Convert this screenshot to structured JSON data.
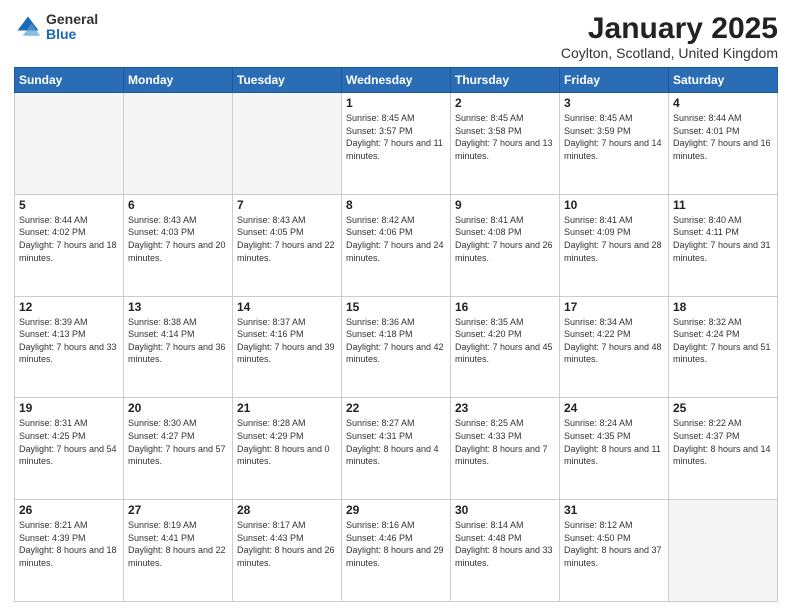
{
  "logo": {
    "general": "General",
    "blue": "Blue"
  },
  "header": {
    "title": "January 2025",
    "location": "Coylton, Scotland, United Kingdom"
  },
  "days_of_week": [
    "Sunday",
    "Monday",
    "Tuesday",
    "Wednesday",
    "Thursday",
    "Friday",
    "Saturday"
  ],
  "weeks": [
    [
      {
        "day": "",
        "info": ""
      },
      {
        "day": "",
        "info": ""
      },
      {
        "day": "",
        "info": ""
      },
      {
        "day": "1",
        "info": "Sunrise: 8:45 AM\nSunset: 3:57 PM\nDaylight: 7 hours\nand 11 minutes."
      },
      {
        "day": "2",
        "info": "Sunrise: 8:45 AM\nSunset: 3:58 PM\nDaylight: 7 hours\nand 13 minutes."
      },
      {
        "day": "3",
        "info": "Sunrise: 8:45 AM\nSunset: 3:59 PM\nDaylight: 7 hours\nand 14 minutes."
      },
      {
        "day": "4",
        "info": "Sunrise: 8:44 AM\nSunset: 4:01 PM\nDaylight: 7 hours\nand 16 minutes."
      }
    ],
    [
      {
        "day": "5",
        "info": "Sunrise: 8:44 AM\nSunset: 4:02 PM\nDaylight: 7 hours\nand 18 minutes."
      },
      {
        "day": "6",
        "info": "Sunrise: 8:43 AM\nSunset: 4:03 PM\nDaylight: 7 hours\nand 20 minutes."
      },
      {
        "day": "7",
        "info": "Sunrise: 8:43 AM\nSunset: 4:05 PM\nDaylight: 7 hours\nand 22 minutes."
      },
      {
        "day": "8",
        "info": "Sunrise: 8:42 AM\nSunset: 4:06 PM\nDaylight: 7 hours\nand 24 minutes."
      },
      {
        "day": "9",
        "info": "Sunrise: 8:41 AM\nSunset: 4:08 PM\nDaylight: 7 hours\nand 26 minutes."
      },
      {
        "day": "10",
        "info": "Sunrise: 8:41 AM\nSunset: 4:09 PM\nDaylight: 7 hours\nand 28 minutes."
      },
      {
        "day": "11",
        "info": "Sunrise: 8:40 AM\nSunset: 4:11 PM\nDaylight: 7 hours\nand 31 minutes."
      }
    ],
    [
      {
        "day": "12",
        "info": "Sunrise: 8:39 AM\nSunset: 4:13 PM\nDaylight: 7 hours\nand 33 minutes."
      },
      {
        "day": "13",
        "info": "Sunrise: 8:38 AM\nSunset: 4:14 PM\nDaylight: 7 hours\nand 36 minutes."
      },
      {
        "day": "14",
        "info": "Sunrise: 8:37 AM\nSunset: 4:16 PM\nDaylight: 7 hours\nand 39 minutes."
      },
      {
        "day": "15",
        "info": "Sunrise: 8:36 AM\nSunset: 4:18 PM\nDaylight: 7 hours\nand 42 minutes."
      },
      {
        "day": "16",
        "info": "Sunrise: 8:35 AM\nSunset: 4:20 PM\nDaylight: 7 hours\nand 45 minutes."
      },
      {
        "day": "17",
        "info": "Sunrise: 8:34 AM\nSunset: 4:22 PM\nDaylight: 7 hours\nand 48 minutes."
      },
      {
        "day": "18",
        "info": "Sunrise: 8:32 AM\nSunset: 4:24 PM\nDaylight: 7 hours\nand 51 minutes."
      }
    ],
    [
      {
        "day": "19",
        "info": "Sunrise: 8:31 AM\nSunset: 4:25 PM\nDaylight: 7 hours\nand 54 minutes."
      },
      {
        "day": "20",
        "info": "Sunrise: 8:30 AM\nSunset: 4:27 PM\nDaylight: 7 hours\nand 57 minutes."
      },
      {
        "day": "21",
        "info": "Sunrise: 8:28 AM\nSunset: 4:29 PM\nDaylight: 8 hours\nand 0 minutes."
      },
      {
        "day": "22",
        "info": "Sunrise: 8:27 AM\nSunset: 4:31 PM\nDaylight: 8 hours\nand 4 minutes."
      },
      {
        "day": "23",
        "info": "Sunrise: 8:25 AM\nSunset: 4:33 PM\nDaylight: 8 hours\nand 7 minutes."
      },
      {
        "day": "24",
        "info": "Sunrise: 8:24 AM\nSunset: 4:35 PM\nDaylight: 8 hours\nand 11 minutes."
      },
      {
        "day": "25",
        "info": "Sunrise: 8:22 AM\nSunset: 4:37 PM\nDaylight: 8 hours\nand 14 minutes."
      }
    ],
    [
      {
        "day": "26",
        "info": "Sunrise: 8:21 AM\nSunset: 4:39 PM\nDaylight: 8 hours\nand 18 minutes."
      },
      {
        "day": "27",
        "info": "Sunrise: 8:19 AM\nSunset: 4:41 PM\nDaylight: 8 hours\nand 22 minutes."
      },
      {
        "day": "28",
        "info": "Sunrise: 8:17 AM\nSunset: 4:43 PM\nDaylight: 8 hours\nand 26 minutes."
      },
      {
        "day": "29",
        "info": "Sunrise: 8:16 AM\nSunset: 4:46 PM\nDaylight: 8 hours\nand 29 minutes."
      },
      {
        "day": "30",
        "info": "Sunrise: 8:14 AM\nSunset: 4:48 PM\nDaylight: 8 hours\nand 33 minutes."
      },
      {
        "day": "31",
        "info": "Sunrise: 8:12 AM\nSunset: 4:50 PM\nDaylight: 8 hours\nand 37 minutes."
      },
      {
        "day": "",
        "info": ""
      }
    ]
  ]
}
